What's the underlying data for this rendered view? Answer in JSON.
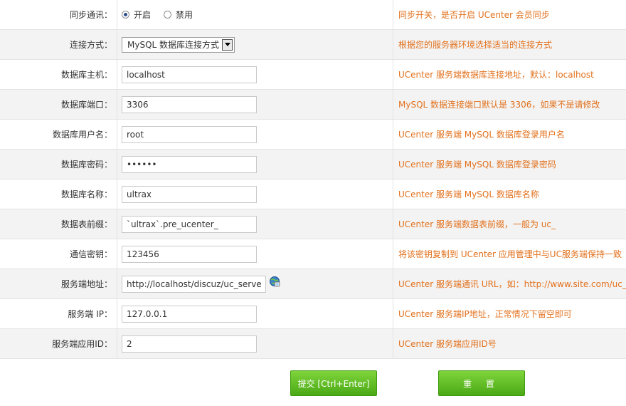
{
  "rows": [
    {
      "label": "同步通讯：",
      "type": "radio",
      "options": [
        "开启",
        "禁用"
      ],
      "selected": 0,
      "tip": "同步开关，是否开启 UCenter 会员同步"
    },
    {
      "label": "连接方式：",
      "type": "select",
      "value": "MySQL 数据库连接方式",
      "tip": "根据您的服务器环境选择适当的连接方式"
    },
    {
      "label": "数据库主机：",
      "type": "text",
      "value": "localhost",
      "tip": "UCenter 服务端数据库连接地址，默认：localhost"
    },
    {
      "label": "数据库端口：",
      "type": "text",
      "value": "3306",
      "tip": "MySQL 数据连接端口默认是 3306，如果不是请修改"
    },
    {
      "label": "数据库用户名：",
      "type": "text",
      "value": "root",
      "tip": "UCenter 服务端 MySQL 数据库登录用户名"
    },
    {
      "label": "数据库密码：",
      "type": "password",
      "value": "••••••",
      "tip": "UCenter 服务端 MySQL 数据库登录密码"
    },
    {
      "label": "数据库名称：",
      "type": "text",
      "value": "ultrax",
      "tip": "UCenter 服务端 MySQL 数据库名称"
    },
    {
      "label": "数据表前缀：",
      "type": "text",
      "value": "`ultrax`.pre_ucenter_",
      "tip": "UCenter 服务端数据表前缀，一般为 uc_"
    },
    {
      "label": "通信密钥：",
      "type": "text",
      "value": "123456",
      "tip": "将该密钥复制到 UCenter 应用管理中与UC服务端保持一致"
    },
    {
      "label": "服务端地址：",
      "type": "url",
      "value": "http://localhost/discuz/uc_server",
      "icon": "globe-icon",
      "tip": "UCenter 服务端通讯 URL，如：http://www.site.com/uc_server"
    },
    {
      "label": "服务端 IP：",
      "type": "text",
      "value": "127.0.0.1",
      "tip": "UCenter 服务端IP地址，正常情况下留空即可"
    },
    {
      "label": "服务端应用ID：",
      "type": "text",
      "value": "2",
      "tip": "UCenter 服务端应用ID号"
    }
  ],
  "buttons": {
    "submit": "提交 [Ctrl+Enter]",
    "reset": "重 置"
  },
  "colors": {
    "tip": "#e2711d",
    "button_green": "#5cb822",
    "row_alt": "#f3f3f3"
  }
}
